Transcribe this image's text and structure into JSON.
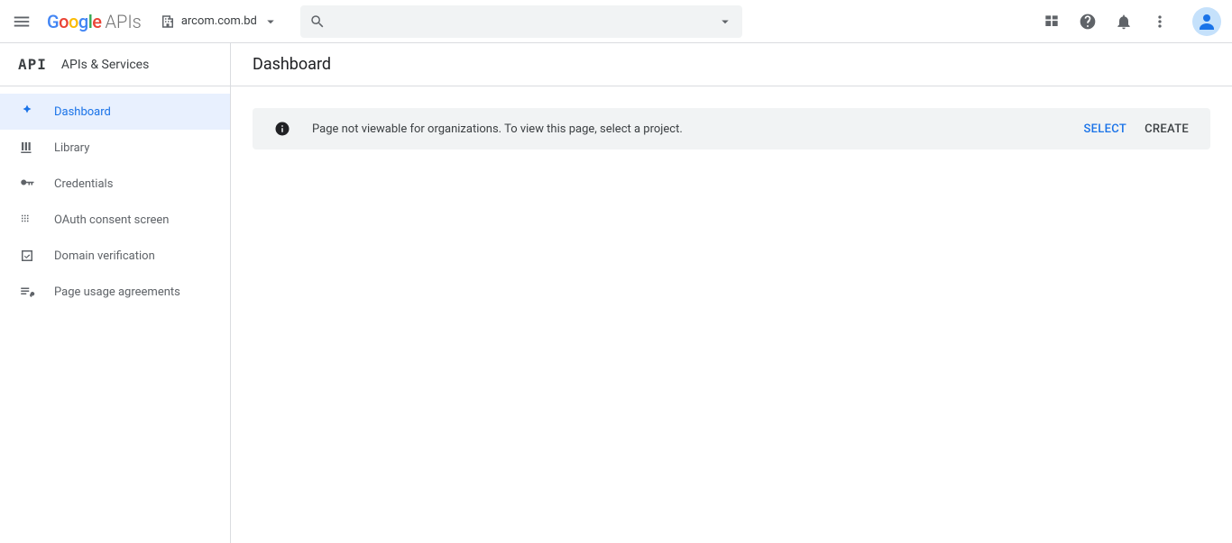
{
  "header": {
    "logo_apis": "APIs",
    "project_name": "arcom.com.bd",
    "search_placeholder": ""
  },
  "sidebar": {
    "badge": "API",
    "title": "APIs & Services",
    "items": [
      {
        "label": "Dashboard"
      },
      {
        "label": "Library"
      },
      {
        "label": "Credentials"
      },
      {
        "label": "OAuth consent screen"
      },
      {
        "label": "Domain verification"
      },
      {
        "label": "Page usage agreements"
      }
    ]
  },
  "main": {
    "title": "Dashboard",
    "banner": {
      "message": "Page not viewable for organizations. To view this page, select a project.",
      "select_label": "SELECT",
      "create_label": "CREATE"
    }
  }
}
